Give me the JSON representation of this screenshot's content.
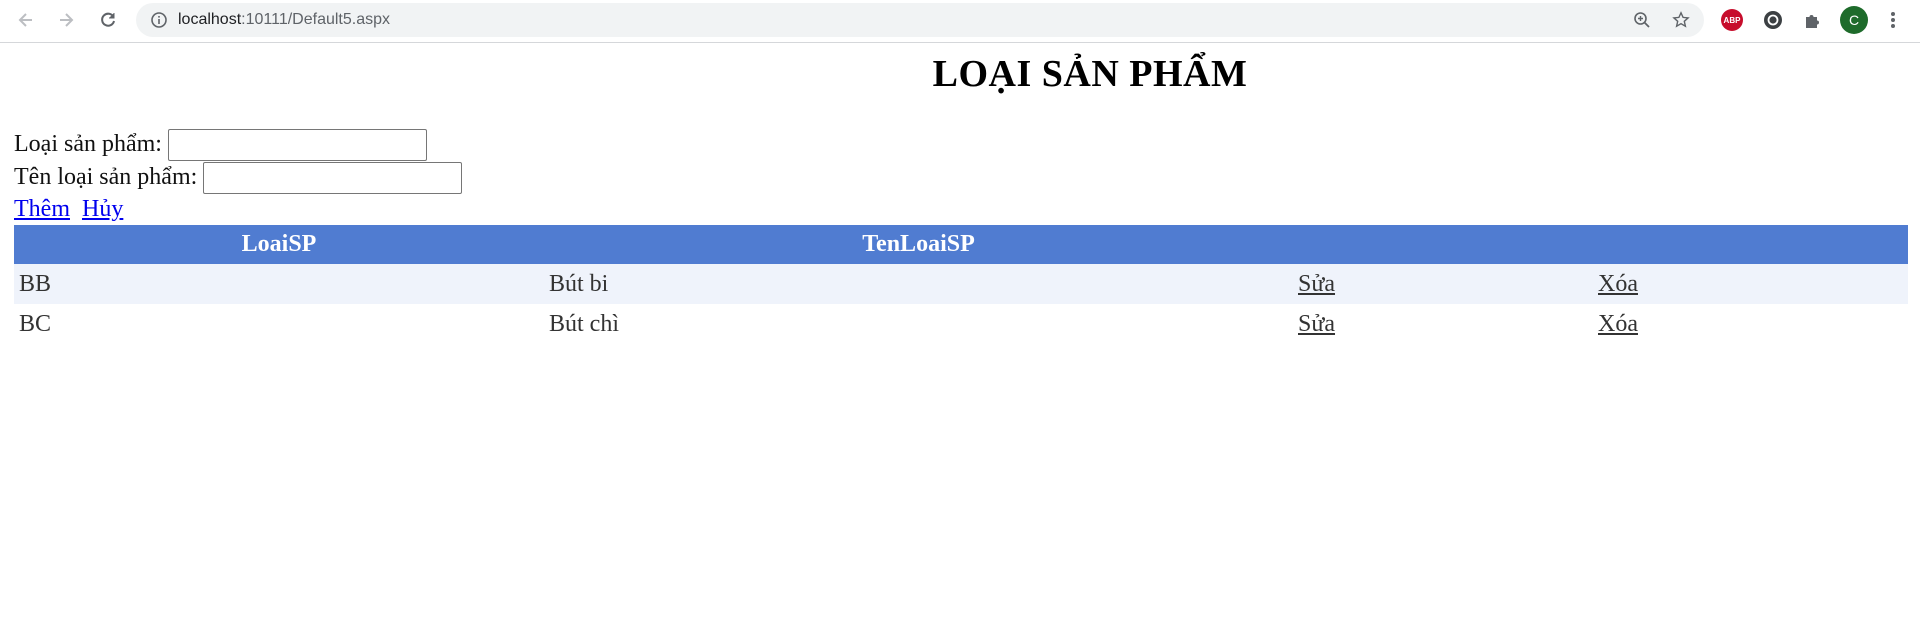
{
  "browser": {
    "url_host": "localhost",
    "url_path": ":10111/Default5.aspx",
    "profile_initial": "C",
    "extension_abp_label": "ABP"
  },
  "page": {
    "title": "LOẠI SẢN PHẨM",
    "form": {
      "loaisp_label": "Loại sản phẩm:",
      "loaisp_value": "",
      "tenloaisp_label": "Tên loại sản phẩm:",
      "tenloaisp_value": "",
      "add_link": "Thêm",
      "cancel_link": "Hủy"
    },
    "grid": {
      "headers": [
        "LoaiSP",
        "TenLoaiSP",
        "",
        ""
      ],
      "rows": [
        {
          "loaisp": "BB",
          "tenloaisp": "Bút bi",
          "edit": "Sửa",
          "delete": "Xóa"
        },
        {
          "loaisp": "BC",
          "tenloaisp": "Bút chì",
          "edit": "Sửa",
          "delete": "Xóa"
        }
      ],
      "header_color": "#507cd1",
      "alt_row_color": "#eff3fb"
    }
  }
}
